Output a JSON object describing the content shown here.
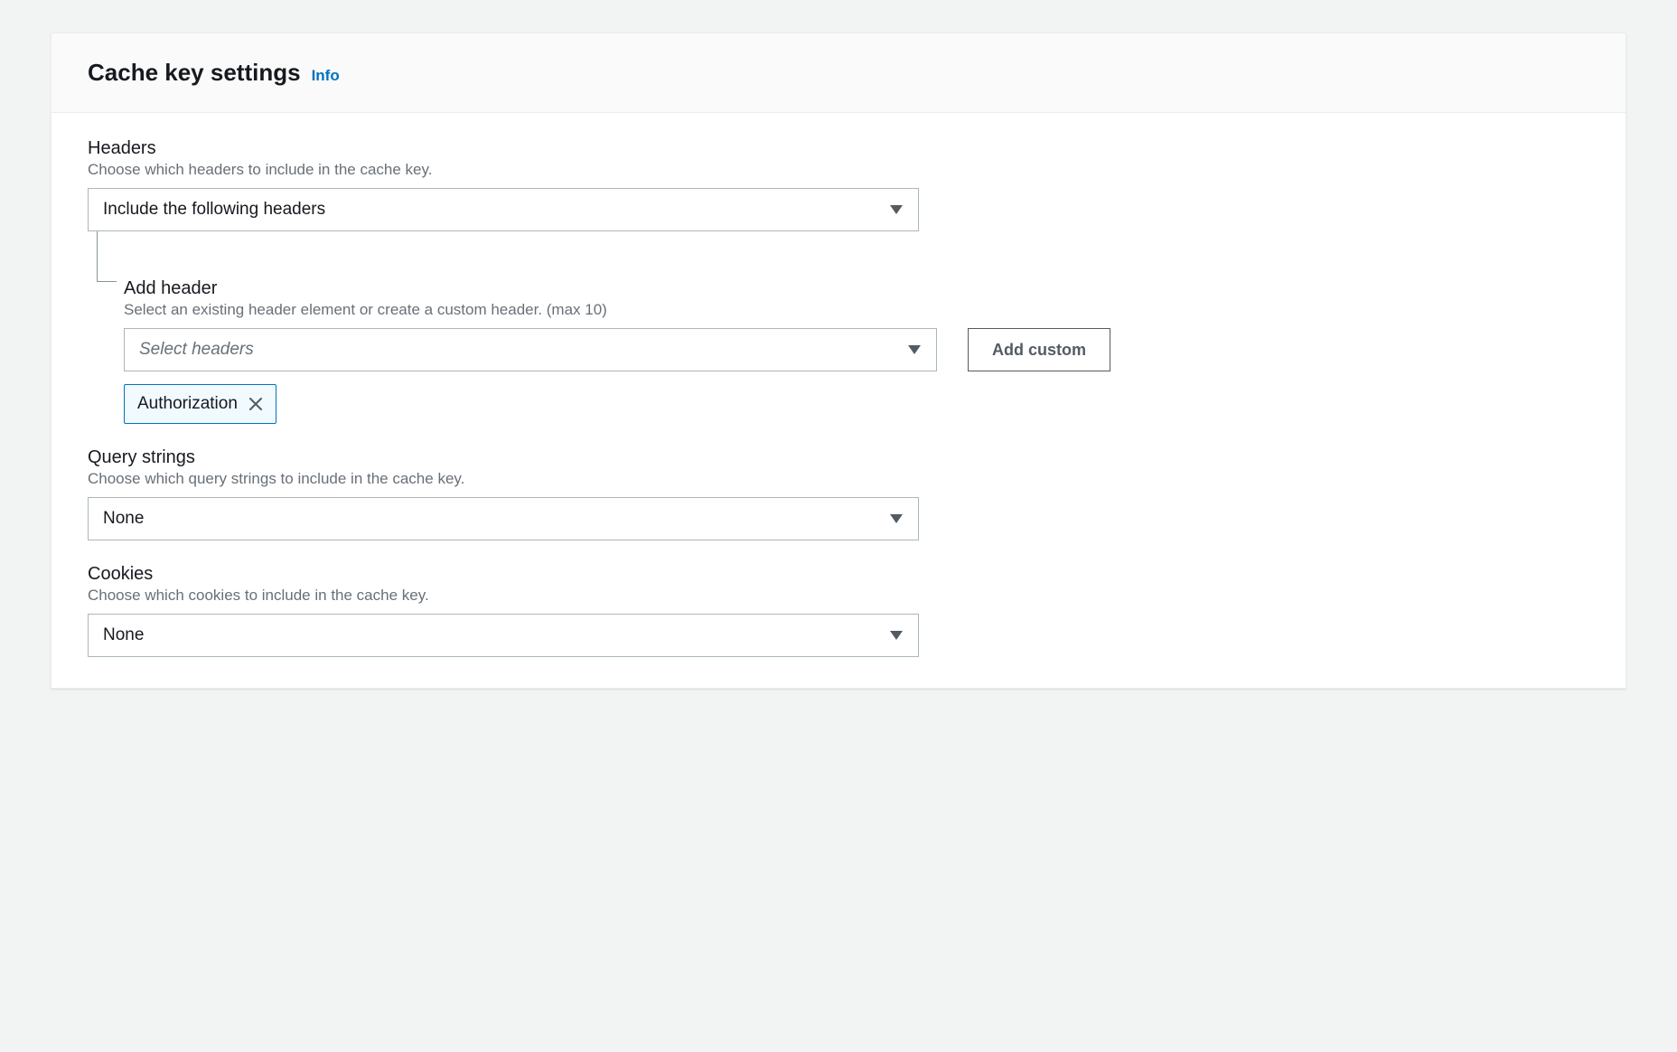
{
  "panel": {
    "title": "Cache key settings",
    "info_link": "Info"
  },
  "headers": {
    "label": "Headers",
    "description": "Choose which headers to include in the cache key.",
    "selected": "Include the following headers",
    "add_header": {
      "label": "Add header",
      "description": "Select an existing header element or create a custom header. (max 10)",
      "placeholder": "Select headers",
      "add_custom_button": "Add custom",
      "tokens": [
        "Authorization"
      ]
    }
  },
  "query_strings": {
    "label": "Query strings",
    "description": "Choose which query strings to include in the cache key.",
    "selected": "None"
  },
  "cookies": {
    "label": "Cookies",
    "description": "Choose which cookies to include in the cache key.",
    "selected": "None"
  }
}
